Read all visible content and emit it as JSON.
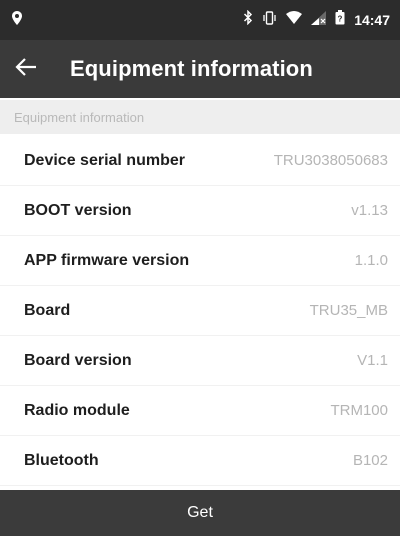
{
  "status_bar": {
    "time": "14:47",
    "icons": [
      "location-pin-icon",
      "bluetooth-icon",
      "vibrate-icon",
      "wifi-icon",
      "cellular-signal-icon",
      "battery-icon"
    ]
  },
  "app_bar": {
    "back_icon": "back-arrow-icon",
    "title": "Equipment information"
  },
  "section": {
    "header": "Equipment information"
  },
  "rows": [
    {
      "label": "Device serial number",
      "value": "TRU3038050683"
    },
    {
      "label": "BOOT version",
      "value": "v1.13"
    },
    {
      "label": "APP firmware version",
      "value": "1.1.0"
    },
    {
      "label": "Board",
      "value": "TRU35_MB"
    },
    {
      "label": "Board version",
      "value": "V1.1"
    },
    {
      "label": "Radio module",
      "value": "TRM100"
    },
    {
      "label": "Bluetooth",
      "value": "B102"
    }
  ],
  "footer": {
    "get_label": "Get"
  },
  "colors": {
    "status_bar_bg": "#2c2c2c",
    "app_bar_bg": "#3a3a3a",
    "section_header_bg": "#eeeeee",
    "button_bg": "#3b3b3b",
    "value_text": "#b5b5b5"
  }
}
